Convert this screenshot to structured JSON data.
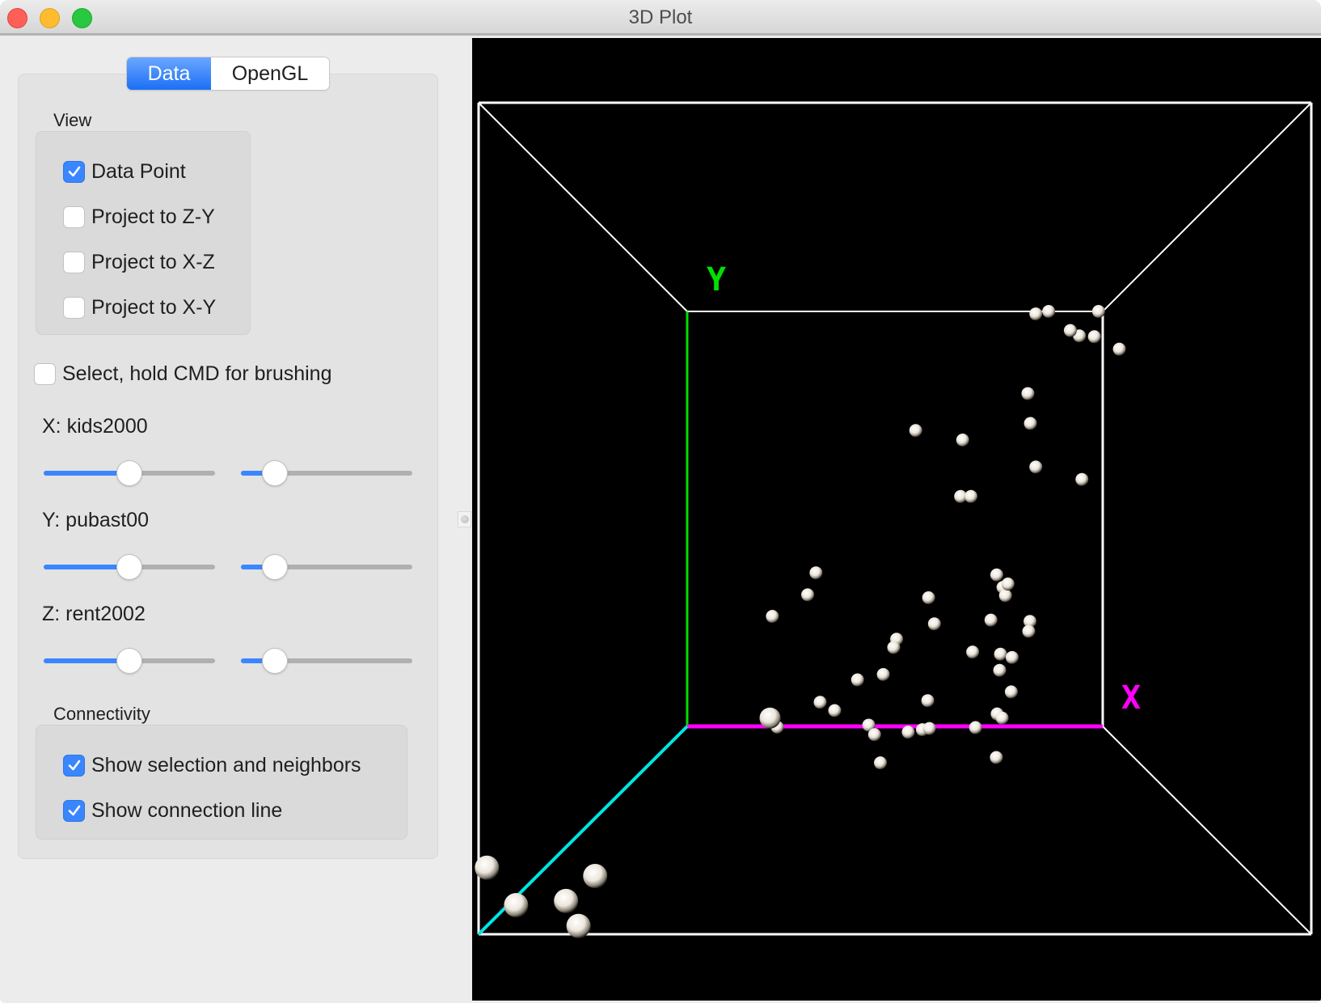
{
  "window": {
    "title": "3D Plot"
  },
  "tabs": [
    {
      "label": "Data",
      "active": true
    },
    {
      "label": "OpenGL",
      "active": false
    }
  ],
  "view_group": {
    "label": "View",
    "options": [
      {
        "label": "Data Point",
        "checked": true
      },
      {
        "label": "Project to Z-Y",
        "checked": false
      },
      {
        "label": "Project to X-Z",
        "checked": false
      },
      {
        "label": "Project to X-Y",
        "checked": false
      }
    ]
  },
  "select_option": {
    "label": "Select, hold CMD for brushing",
    "checked": false
  },
  "axes": [
    {
      "label": "X: kids2000",
      "slider1": 0.5,
      "slider2": 0.15
    },
    {
      "label": "Y: pubast00",
      "slider1": 0.5,
      "slider2": 0.15
    },
    {
      "label": "Z: rent2002",
      "slider1": 0.5,
      "slider2": 0.15
    }
  ],
  "connectivity_group": {
    "label": "Connectivity",
    "options": [
      {
        "label": "Show selection and neighbors",
        "checked": true
      },
      {
        "label": "Show connection line",
        "checked": true
      }
    ]
  },
  "plot": {
    "axis_labels": {
      "x": "X",
      "y": "Y"
    },
    "colors": {
      "x_axis": "#ff00ff",
      "y_axis": "#00e000",
      "z_axis": "#00e5e5",
      "box": "#ffffff",
      "background": "#000000",
      "point": "#f4efe6"
    },
    "points": [
      [
        0.944,
        0.059,
        0.0
      ],
      [
        0.839,
        0.006,
        0.0
      ],
      [
        0.99,
        0.0,
        0.0
      ],
      [
        0.922,
        0.046,
        0.0
      ],
      [
        0.98,
        0.061,
        0.0
      ],
      [
        1.04,
        0.091,
        0.0
      ],
      [
        0.82,
        0.198,
        0.0
      ],
      [
        0.826,
        0.27,
        0.0
      ],
      [
        0.55,
        0.287,
        0.0
      ],
      [
        0.663,
        0.31,
        0.0
      ],
      [
        0.839,
        0.375,
        0.0
      ],
      [
        0.95,
        0.405,
        0.0
      ],
      [
        0.658,
        0.446,
        0.0
      ],
      [
        0.683,
        0.446,
        0.0
      ],
      [
        0.31,
        0.63,
        0.0
      ],
      [
        0.29,
        0.683,
        0.0
      ],
      [
        0.745,
        0.635,
        0.0
      ],
      [
        0.76,
        0.665,
        0.0
      ],
      [
        0.766,
        0.685,
        0.0
      ],
      [
        0.772,
        0.657,
        0.0
      ],
      [
        0.581,
        0.69,
        0.0
      ],
      [
        0.595,
        0.753,
        0.0
      ],
      [
        0.731,
        0.744,
        0.0
      ],
      [
        0.825,
        0.747,
        0.0
      ],
      [
        0.822,
        0.771,
        0.0
      ],
      [
        0.205,
        0.735,
        0.0
      ],
      [
        0.504,
        0.79,
        0.0
      ],
      [
        0.497,
        0.81,
        0.0
      ],
      [
        0.687,
        0.821,
        0.0
      ],
      [
        0.754,
        0.826,
        0.0
      ],
      [
        0.782,
        0.834,
        0.0
      ],
      [
        0.752,
        0.865,
        0.0
      ],
      [
        0.472,
        0.875,
        0.0
      ],
      [
        0.41,
        0.888,
        0.0
      ],
      [
        0.78,
        0.917,
        0.0
      ],
      [
        0.579,
        0.938,
        0.0
      ],
      [
        0.32,
        0.942,
        0.0
      ],
      [
        0.87,
        0.0,
        0.0
      ],
      [
        0.746,
        0.97,
        0.0
      ],
      [
        0.758,
        0.98,
        0.0
      ],
      [
        0.217,
        1.002,
        0.0
      ],
      [
        0.355,
        0.962,
        0.0
      ],
      [
        0.437,
        0.997,
        0.0
      ],
      [
        0.451,
        1.02,
        0.0
      ],
      [
        0.566,
        1.008,
        0.0
      ],
      [
        0.532,
        1.014,
        0.0
      ],
      [
        0.583,
        1.005,
        0.0
      ],
      [
        0.694,
        1.003,
        0.0
      ],
      [
        0.744,
        1.075,
        0.0
      ],
      [
        0.465,
        1.088,
        0.0
      ]
    ],
    "near_points": [
      [
        0.01,
        0.92
      ],
      [
        0.045,
        0.965
      ],
      [
        0.105,
        0.96
      ],
      [
        0.14,
        0.93
      ],
      [
        0.12,
        0.99
      ],
      [
        0.35,
        0.74
      ]
    ]
  }
}
